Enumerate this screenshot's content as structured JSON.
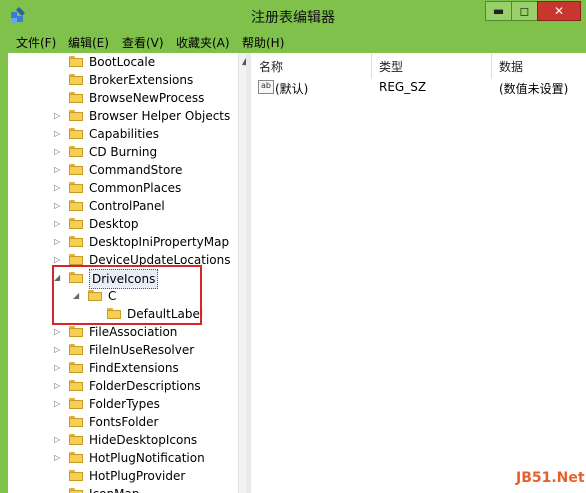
{
  "window": {
    "title": "注册表编辑器",
    "min": "▬",
    "max": "◻",
    "close": "✕"
  },
  "menu": [
    "文件(F)",
    "编辑(E)",
    "查看(V)",
    "收藏夹(A)",
    "帮助(H)"
  ],
  "tree": {
    "items": [
      {
        "label": "BootLocale",
        "expander": ""
      },
      {
        "label": "BrokerExtensions",
        "expander": ""
      },
      {
        "label": "BrowseNewProcess",
        "expander": ""
      },
      {
        "label": "Browser Helper Objects",
        "expander": "▷"
      },
      {
        "label": "Capabilities",
        "expander": "▷"
      },
      {
        "label": "CD Burning",
        "expander": "▷"
      },
      {
        "label": "CommandStore",
        "expander": "▷"
      },
      {
        "label": "CommonPlaces",
        "expander": "▷"
      },
      {
        "label": "ControlPanel",
        "expander": "▷"
      },
      {
        "label": "Desktop",
        "expander": "▷"
      },
      {
        "label": "DesktopIniPropertyMap",
        "expander": "▷"
      },
      {
        "label": "DeviceUpdateLocations",
        "expander": "▷"
      },
      {
        "label": "DriveIcons",
        "expander": "◢"
      },
      {
        "label": "C",
        "expander": "◢"
      },
      {
        "label": "DefaultLabel",
        "expander": ""
      },
      {
        "label": "FileAssociation",
        "expander": "▷"
      },
      {
        "label": "FileInUseResolver",
        "expander": "▷"
      },
      {
        "label": "FindExtensions",
        "expander": "▷"
      },
      {
        "label": "FolderDescriptions",
        "expander": "▷"
      },
      {
        "label": "FolderTypes",
        "expander": "▷"
      },
      {
        "label": "FontsFolder",
        "expander": ""
      },
      {
        "label": "HideDesktopIcons",
        "expander": "▷"
      },
      {
        "label": "HotPlugNotification",
        "expander": "▷"
      },
      {
        "label": "HotPlugProvider",
        "expander": ""
      },
      {
        "label": "IconMap",
        "expander": ""
      }
    ],
    "scroll_up": "▲"
  },
  "values": {
    "headers": {
      "name": "名称",
      "type": "类型",
      "data": "数据"
    },
    "rows": [
      {
        "icon": "ab",
        "name": "(默认)",
        "type": "REG_SZ",
        "data": "(数值未设置)"
      }
    ]
  },
  "watermark": "JB51.Net",
  "colors": {
    "chrome": "#7fc14a",
    "highlight_box": "#d8232a",
    "folder": "#f5cf55"
  }
}
